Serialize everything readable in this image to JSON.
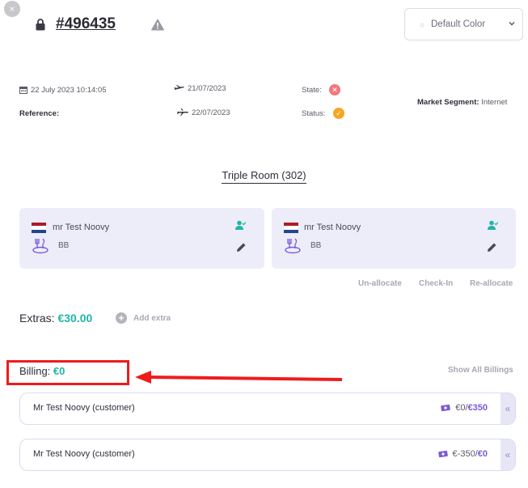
{
  "header": {
    "close_glyph": "×",
    "booking_number": "#496435",
    "color_select": "Default Color"
  },
  "info": {
    "created": "22 July 2023 10:14:05",
    "reference_label": "Reference:",
    "departure_date": "21/07/2023",
    "arrival_date": "22/07/2023",
    "state_label": "State:",
    "status_label": "Status:",
    "market_segment_label": "Market Segment:",
    "market_segment_value": "Internet"
  },
  "room": {
    "title": "Triple Room (302)",
    "guests": [
      {
        "name": "mr Test Noovy",
        "meal": "BB"
      },
      {
        "name": "mr Test Noovy",
        "meal": "BB"
      }
    ],
    "actions": {
      "unallocate": "Un-allocate",
      "checkin": "Check-In",
      "reallocate": "Re-allocate"
    }
  },
  "extras": {
    "label": "Extras:",
    "amount": "€30.00",
    "add_label": "Add extra"
  },
  "billing": {
    "label": "Billing:",
    "amount": "€0",
    "show_all": "Show All Billings",
    "rows": [
      {
        "name": "Mr Test Noovy (customer)",
        "paid": "€0",
        "total": "€350"
      },
      {
        "name": "Mr Test Noovy (customer)",
        "paid": "€-350",
        "total": "€0"
      }
    ]
  },
  "colors": {
    "accent_teal": "#1fb6a6",
    "accent_purple": "#7b5bd6",
    "highlight_red": "#ee1c1c",
    "card_bg": "#ededfa"
  },
  "icons": [
    "close-icon",
    "lock-icon",
    "warning-icon",
    "chevron-down-icon",
    "calendar-icon",
    "plane-departure-icon",
    "plane-arrival-icon",
    "state-x-icon",
    "status-check-icon",
    "flag-nl-icon",
    "meal-icon",
    "guest-check-icon",
    "edit-pencil-icon",
    "plus-icon",
    "money-icon",
    "double-chevron-left-icon"
  ]
}
